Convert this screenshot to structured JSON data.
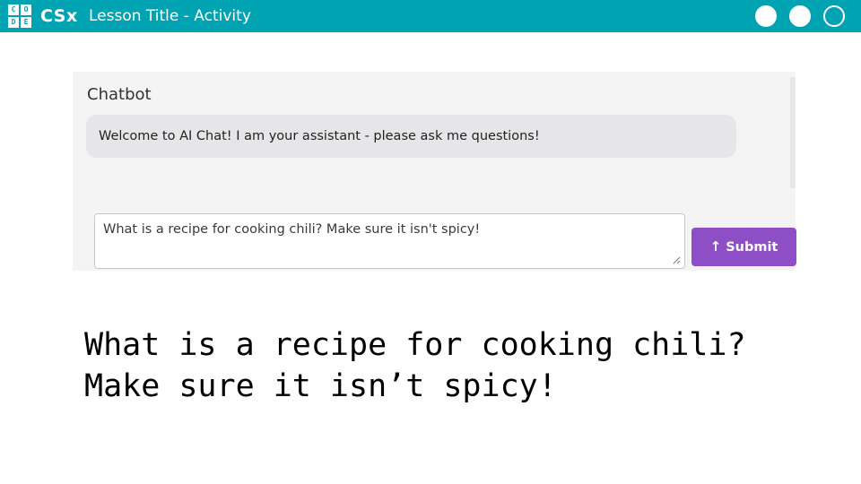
{
  "header": {
    "logo_letters": [
      "C",
      "O",
      "D",
      "E"
    ],
    "brand": "CSx",
    "lesson_title": "Lesson Title - Activity",
    "progress_dots": [
      {
        "name": "progress-dot-1",
        "state": "filled"
      },
      {
        "name": "progress-dot-2",
        "state": "filled"
      },
      {
        "name": "progress-dot-3",
        "state": "hollow"
      }
    ],
    "bar_color": "#00a3b1"
  },
  "chat": {
    "title": "Chatbot",
    "assistant_message": "Welcome to AI Chat! I am your assistant - please ask me questions!",
    "input_value": "What is a recipe for cooking chili? Make sure it isn't spicy!",
    "submit_label": "Submit",
    "submit_icon": "arrow-up-icon",
    "submit_color": "#8e4ec6"
  },
  "caption": {
    "line1": "What is a recipe for cooking chili?",
    "line2": "Make sure it isn’t spicy!"
  }
}
